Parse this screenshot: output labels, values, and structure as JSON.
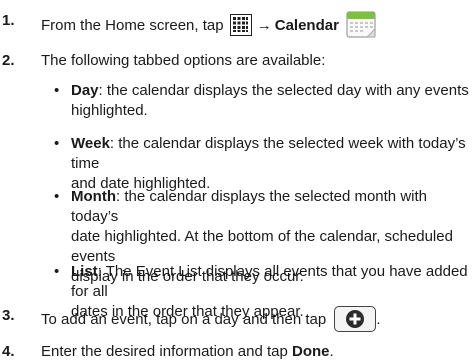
{
  "steps": [
    {
      "number": "1.",
      "text_before": "From the Home screen, tap",
      "arrow": "→",
      "bold_target": "Calendar",
      "icons": [
        "apps-grid-icon",
        "calendar-icon"
      ]
    },
    {
      "number": "2.",
      "text": "The following tabbed options are available:"
    },
    {
      "number": "3.",
      "text": "To add an event, tap on a day and then tap",
      "trailing": ".",
      "icons": [
        "add-event-button-icon"
      ]
    },
    {
      "number": "4.",
      "text_before": "Enter the desired information and tap",
      "bold_target": "Done",
      "trailing": "."
    }
  ],
  "options": [
    {
      "term": "Day",
      "line1": ": the calendar displays the selected day with any events",
      "line2": "highlighted."
    },
    {
      "term": "Week",
      "line1": ": the calendar displays the selected week with today’s time",
      "line2": "and date highlighted."
    },
    {
      "term": "Month",
      "line1": ": the calendar displays the selected month with today’s",
      "line2": "date highlighted. At the bottom of the calendar, scheduled events",
      "line3": "display in the order that they occur."
    },
    {
      "term": "List",
      "line1": ": The Event List displays all events that you have added for all",
      "line2": "dates in the order that they appear."
    }
  ],
  "bullet_glyph": "•",
  "colors": {
    "text": "#1a1a1a",
    "calendar_header": "#7cbf4a"
  }
}
